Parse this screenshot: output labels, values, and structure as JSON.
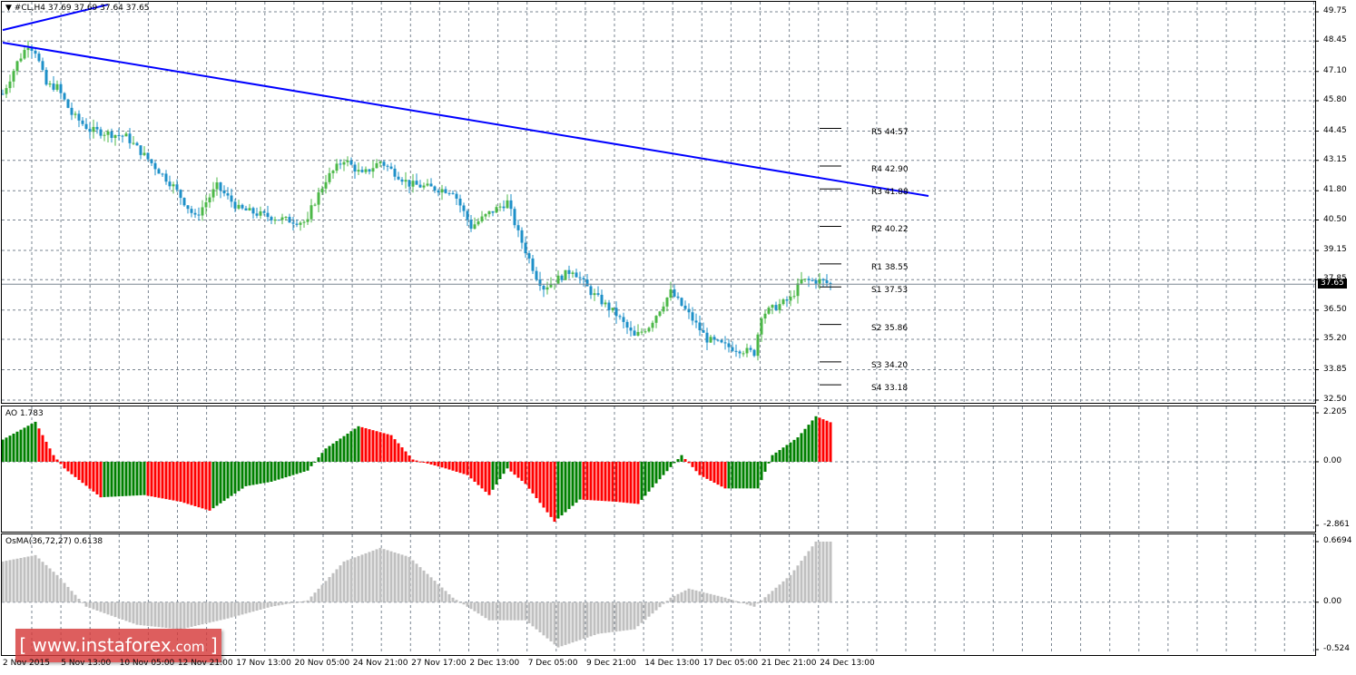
{
  "header": {
    "symbol": "#CL,H4",
    "ohlc": "37.69 37.69 37.64 37.65",
    "menu_icon": "triangle-down-icon"
  },
  "watermark": {
    "bracket_open": "[",
    "text": "www.instaforex",
    "suffix": ".com",
    "bracket_close": "]"
  },
  "current_price": "37.65",
  "chart_data": [
    {
      "type": "candlestick",
      "title": "#CL,H4 37.69 37.69 37.64 37.65",
      "ylim": [
        32.5,
        49.75
      ],
      "y_ticks": [
        "49.75",
        "48.45",
        "47.10",
        "45.80",
        "44.45",
        "43.15",
        "41.80",
        "40.50",
        "39.15",
        "37.85",
        "36.50",
        "35.20",
        "33.85",
        "32.50"
      ],
      "x_ticks": [
        "2 Nov 2015",
        "5 Nov 13:00",
        "10 Nov 05:00",
        "12 Nov 21:00",
        "17 Nov 13:00",
        "20 Nov 05:00",
        "24 Nov 21:00",
        "27 Nov 17:00",
        "2 Dec 13:00",
        "7 Dec 05:00",
        "9 Dec 21:00",
        "14 Dec 13:00",
        "17 Dec 05:00",
        "21 Dec 21:00",
        "24 Dec 13:00"
      ],
      "close_path": [
        [
          0,
          46.1
        ],
        [
          4,
          47.5
        ],
        [
          7,
          48.3
        ],
        [
          9,
          48.0
        ],
        [
          12,
          46.5
        ],
        [
          15,
          46.4
        ],
        [
          19,
          45.2
        ],
        [
          24,
          44.5
        ],
        [
          34,
          44.2
        ],
        [
          40,
          43.2
        ],
        [
          47,
          42.0
        ],
        [
          53,
          40.6
        ],
        [
          59,
          42.0
        ],
        [
          65,
          41.0
        ],
        [
          72,
          40.7
        ],
        [
          78,
          40.5
        ],
        [
          84,
          40.4
        ],
        [
          85,
          41.0
        ],
        [
          89,
          42.3
        ],
        [
          94,
          43.2
        ],
        [
          99,
          42.5
        ],
        [
          104,
          43.1
        ],
        [
          112,
          42.1
        ],
        [
          119,
          41.9
        ],
        [
          124,
          41.8
        ],
        [
          129,
          40.2
        ],
        [
          134,
          40.8
        ],
        [
          139,
          41.3
        ],
        [
          142,
          39.9
        ],
        [
          147,
          38.0
        ],
        [
          149,
          37.5
        ],
        [
          157,
          38.3
        ],
        [
          162,
          37.3
        ],
        [
          169,
          36.3
        ],
        [
          174,
          35.3
        ],
        [
          178,
          35.8
        ],
        [
          182,
          36.8
        ],
        [
          184,
          37.3
        ],
        [
          189,
          36.3
        ],
        [
          194,
          35.2
        ],
        [
          199,
          34.9
        ],
        [
          207,
          34.6
        ],
        [
          209,
          36.3
        ],
        [
          217,
          37.0
        ],
        [
          220,
          37.8
        ],
        [
          225,
          37.8
        ],
        [
          228,
          37.65
        ]
      ],
      "trendlines": [
        {
          "from_bar": 0,
          "from_price": 48.38,
          "to_bar": 255,
          "to_price": 41.57,
          "color": "#0000FF"
        },
        {
          "from_bar": 0,
          "from_price": 48.94,
          "to_bar": 29,
          "to_price": 50.07,
          "color": "#0000FF"
        }
      ],
      "pivots": [
        {
          "label": "R5 44.57",
          "value": 44.57
        },
        {
          "label": "R4 42.90",
          "value": 42.9
        },
        {
          "label": "R3 41.88",
          "value": 41.88
        },
        {
          "label": "R2 40.22",
          "value": 40.22
        },
        {
          "label": "R1 38.55",
          "value": 38.55
        },
        {
          "label": "S1 37.53",
          "value": 37.53
        },
        {
          "label": "S2 35.86",
          "value": 35.86
        },
        {
          "label": "S3 34.20",
          "value": 34.2
        },
        {
          "label": "S4 33.18",
          "value": 33.18
        }
      ],
      "colors": {
        "bull": "#4CB848",
        "bear": "#1E90C8"
      }
    },
    {
      "type": "bar",
      "title": "AO 1.783",
      "ylim": [
        -2.861,
        2.205
      ],
      "y_ticks": [
        "2.205",
        "0.00",
        "-2.861"
      ],
      "path": [
        [
          0,
          1.0
        ],
        [
          9,
          1.8
        ],
        [
          14,
          0.3
        ],
        [
          17,
          -0.3
        ],
        [
          27,
          -1.6
        ],
        [
          39,
          -1.5
        ],
        [
          49,
          -1.8
        ],
        [
          57,
          -2.2
        ],
        [
          67,
          -1.1
        ],
        [
          74,
          -0.9
        ],
        [
          84,
          -0.4
        ],
        [
          89,
          0.6
        ],
        [
          98,
          1.6
        ],
        [
          107,
          1.2
        ],
        [
          113,
          0.1
        ],
        [
          122,
          -0.3
        ],
        [
          128,
          -0.6
        ],
        [
          134,
          -1.5
        ],
        [
          139,
          -0.3
        ],
        [
          144,
          -1.0
        ],
        [
          152,
          -2.7
        ],
        [
          159,
          -1.7
        ],
        [
          169,
          -1.8
        ],
        [
          175,
          -1.9
        ],
        [
          182,
          -0.6
        ],
        [
          187,
          0.3
        ],
        [
          192,
          -0.6
        ],
        [
          199,
          -1.2
        ],
        [
          208,
          -1.2
        ],
        [
          212,
          0.3
        ],
        [
          219,
          1.1
        ],
        [
          224,
          2.05
        ],
        [
          228,
          1.78
        ]
      ],
      "colors": {
        "up": "#008000",
        "down": "#FF0000"
      }
    },
    {
      "type": "bar",
      "title": "OsMA(36,72,27) 0.6138",
      "ylim": [
        -0.524,
        0.6694
      ],
      "y_ticks": [
        "0.6694",
        "0.00",
        "-0.524"
      ],
      "path": [
        [
          0,
          0.45
        ],
        [
          9,
          0.52
        ],
        [
          15,
          0.3
        ],
        [
          23,
          -0.05
        ],
        [
          37,
          -0.25
        ],
        [
          49,
          -0.3
        ],
        [
          62,
          -0.18
        ],
        [
          74,
          -0.05
        ],
        [
          84,
          0.02
        ],
        [
          94,
          0.45
        ],
        [
          104,
          0.6
        ],
        [
          112,
          0.5
        ],
        [
          124,
          0.05
        ],
        [
          134,
          -0.2
        ],
        [
          144,
          -0.2
        ],
        [
          153,
          -0.5
        ],
        [
          164,
          -0.35
        ],
        [
          174,
          -0.3
        ],
        [
          184,
          0.05
        ],
        [
          189,
          0.15
        ],
        [
          199,
          0.05
        ],
        [
          207,
          -0.05
        ],
        [
          217,
          0.3
        ],
        [
          224,
          0.67
        ],
        [
          228,
          0.67
        ]
      ],
      "colors": {
        "bar": "#C0C0C0"
      }
    }
  ]
}
